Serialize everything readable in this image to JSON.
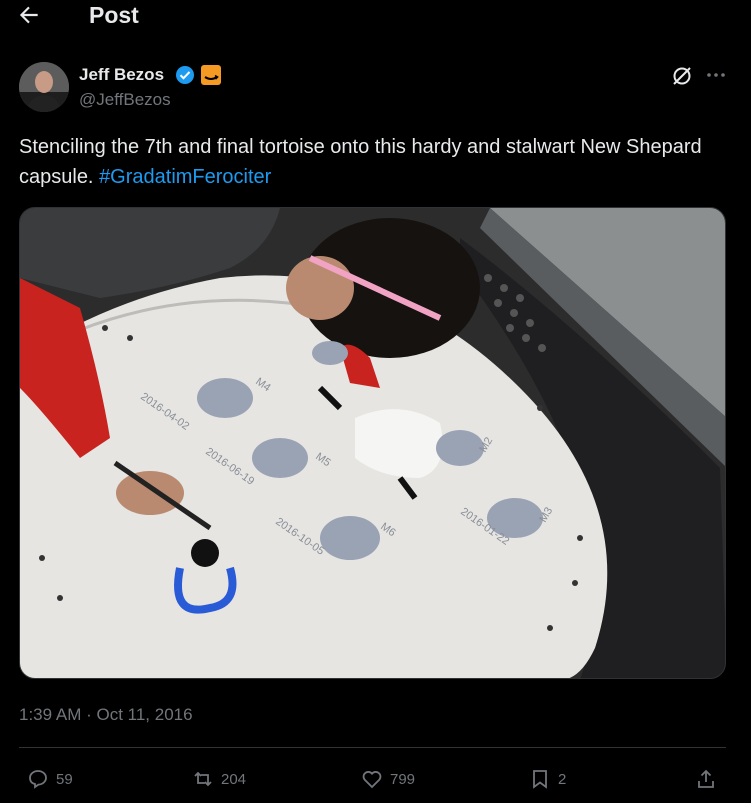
{
  "header": {
    "title": "Post",
    "back_icon": "arrow-left-icon"
  },
  "author": {
    "name": "Jeff Bezos",
    "handle": "@JeffBezos",
    "verified_color": "#1d9bf0",
    "affiliate_color": "#f59a23"
  },
  "post": {
    "text": "Stenciling the 7th and final tortoise onto this hardy and stalwart New Shepard capsule.",
    "hashtag": "#GradatimFerociter",
    "hashtag_color": "#1d9bf0",
    "timestamp": "1:39 AM · Oct 11, 2016"
  },
  "stencils": [
    {
      "code": "M4",
      "date": "2016-04-02"
    },
    {
      "code": "M5",
      "date": "2016-06-19"
    },
    {
      "code": "M6",
      "date": "2016-10-05"
    },
    {
      "code": "M2",
      "date": ""
    },
    {
      "code": "M3",
      "date": "2016-01-22"
    }
  ],
  "actions": {
    "replies": "59",
    "reposts": "204",
    "likes": "799",
    "bookmarks": "2",
    "icons": [
      "reply-icon",
      "repost-icon",
      "like-icon",
      "bookmark-icon",
      "share-icon"
    ]
  }
}
